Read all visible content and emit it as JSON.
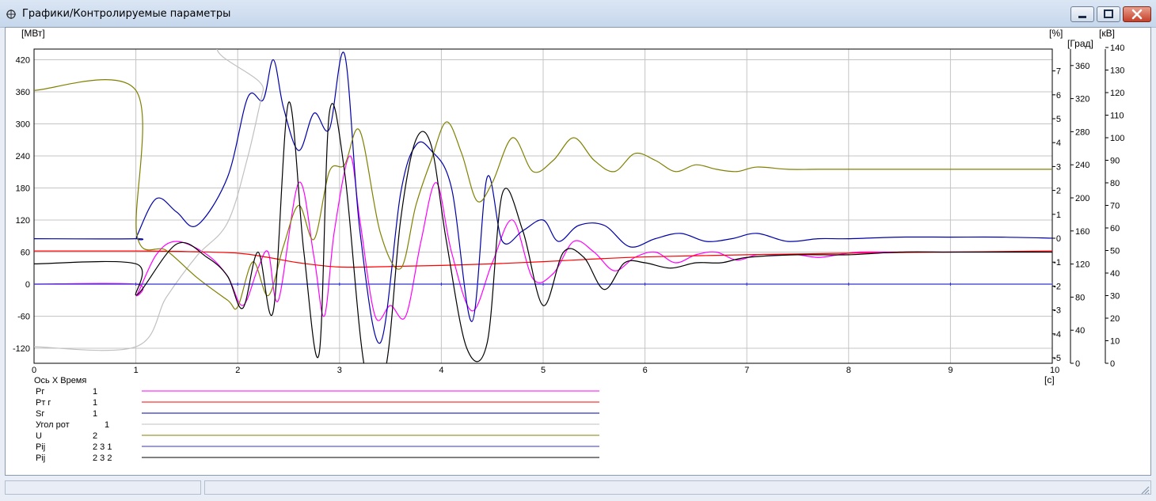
{
  "window": {
    "title": "Графики/Контролируемые параметры",
    "minimize_glyph": "—",
    "maximize_glyph": "▣",
    "close_glyph": "✕"
  },
  "axes": {
    "left_unit": "[МВт]",
    "left_ticks": [
      "420",
      "360",
      "300",
      "240",
      "180",
      "120",
      "60",
      "0",
      "-60",
      "-120"
    ],
    "pct_unit": "[%]",
    "pct_ticks": [
      "7",
      "6",
      "5",
      "4",
      "3",
      "2",
      "1",
      "0",
      "-1",
      "-2",
      "-3",
      "-4",
      "-5"
    ],
    "deg_unit": "[Град]",
    "deg_ticks": [
      "360",
      "320",
      "280",
      "240",
      "200",
      "160",
      "120",
      "80",
      "40",
      "0"
    ],
    "kv_unit": "[кВ]",
    "kv_ticks": [
      "140",
      "130",
      "120",
      "110",
      "100",
      "90",
      "80",
      "70",
      "60",
      "50",
      "40",
      "30",
      "20",
      "10",
      "0"
    ],
    "x_ticks": [
      "0",
      "1",
      "2",
      "3",
      "4",
      "5",
      "6",
      "7",
      "8",
      "9",
      "10"
    ],
    "x_unit": "[с]"
  },
  "legend": {
    "axis_label": "Ось X  Время",
    "items": [
      {
        "name": "Pг",
        "index": "1",
        "color": "#ff00ff"
      },
      {
        "name": "Pт г",
        "index": "1",
        "color": "#ff0000"
      },
      {
        "name": "Sг",
        "index": "1",
        "color": "#0000aa"
      },
      {
        "name": "Угол рот",
        "index": "1",
        "color": "#c0c0c0"
      },
      {
        "name": "U",
        "index": "2",
        "color": "#808000"
      },
      {
        "name": "Pij",
        "index": "2  3  1",
        "color": "#3333cc"
      },
      {
        "name": "Pij",
        "index": "2  3  2",
        "color": "#000000"
      }
    ]
  },
  "chart_data": {
    "type": "line",
    "xlim": [
      0,
      10
    ],
    "ylim_left": [
      -140,
      440
    ],
    "series": [
      {
        "name": "Pг",
        "axis": "МВт",
        "color": "#ff00ff",
        "x": [
          0,
          1,
          1.01,
          1.2,
          1.4,
          1.7,
          1.9,
          2.05,
          2.2,
          2.3,
          2.4,
          2.6,
          2.75,
          2.85,
          2.95,
          3.1,
          3.2,
          3.35,
          3.5,
          3.65,
          3.8,
          3.95,
          4.1,
          4.3,
          4.5,
          4.7,
          4.9,
          5.1,
          5.3,
          5.5,
          5.7,
          5.9,
          6.1,
          6.3,
          6.5,
          6.7,
          6.9,
          7.1,
          7.3,
          7.5,
          7.7,
          7.9,
          8.1,
          8.5,
          9,
          9.5,
          10
        ],
        "y": [
          0,
          0,
          -20,
          55,
          80,
          55,
          15,
          -40,
          30,
          60,
          -30,
          190,
          50,
          -60,
          100,
          240,
          120,
          -60,
          -40,
          -60,
          80,
          190,
          60,
          -50,
          40,
          120,
          10,
          20,
          80,
          60,
          25,
          50,
          60,
          40,
          55,
          60,
          45,
          55,
          55,
          55,
          50,
          55,
          60,
          60,
          60,
          60,
          60
        ]
      },
      {
        "name": "Pт г",
        "axis": "МВт",
        "color": "#ff0000",
        "x": [
          0,
          1,
          1.5,
          2,
          2.3,
          2.6,
          3,
          3.5,
          4,
          4.5,
          5,
          5.5,
          6,
          7,
          8,
          9,
          10
        ],
        "y": [
          62,
          62,
          61,
          58,
          50,
          40,
          32,
          33,
          35,
          38,
          42,
          47,
          51,
          55,
          58,
          60,
          62
        ]
      },
      {
        "name": "Sг",
        "axis": "МВт",
        "color": "#0000aa",
        "x": [
          0,
          1,
          1.01,
          1.2,
          1.4,
          1.6,
          1.9,
          2.1,
          2.25,
          2.35,
          2.45,
          2.6,
          2.75,
          2.9,
          3.05,
          3.2,
          3.4,
          3.6,
          3.75,
          3.9,
          4.1,
          4.3,
          4.45,
          4.6,
          4.8,
          5,
          5.15,
          5.35,
          5.6,
          5.85,
          6.1,
          6.35,
          6.6,
          6.85,
          7.1,
          7.4,
          7.7,
          8,
          8.5,
          9,
          9.5,
          10
        ],
        "y": [
          85,
          85,
          90,
          160,
          135,
          110,
          200,
          350,
          345,
          420,
          330,
          250,
          320,
          290,
          430,
          100,
          -110,
          170,
          260,
          250,
          180,
          -70,
          200,
          80,
          100,
          120,
          80,
          110,
          110,
          70,
          85,
          95,
          80,
          85,
          95,
          80,
          85,
          85,
          88,
          88,
          88,
          86
        ]
      },
      {
        "name": "Угол рот",
        "axis": "Град",
        "color": "#c0c0c0",
        "x": [
          0,
          1,
          1.3,
          1.6,
          1.9,
          2.1,
          2.25,
          2.4,
          10
        ],
        "y": [
          20,
          20,
          80,
          130,
          170,
          250,
          330,
          400,
          400
        ]
      },
      {
        "name": "U",
        "axis": "кВ",
        "color": "#808000",
        "x": [
          0,
          1,
          1.01,
          1.3,
          1.6,
          1.9,
          2,
          2.15,
          2.3,
          2.45,
          2.6,
          2.75,
          2.9,
          3.05,
          3.2,
          3.4,
          3.6,
          3.75,
          3.9,
          4.05,
          4.2,
          4.35,
          4.5,
          4.7,
          4.9,
          5.1,
          5.3,
          5.5,
          5.7,
          5.9,
          6.1,
          6.3,
          6.5,
          6.7,
          6.9,
          7.1,
          7.4,
          7.7,
          8,
          8.5,
          9,
          9.5,
          10
        ],
        "y": [
          121,
          121,
          57,
          50,
          38,
          28,
          25,
          45,
          30,
          52,
          70,
          55,
          85,
          88,
          103,
          58,
          42,
          70,
          90,
          107,
          93,
          72,
          80,
          100,
          85,
          90,
          100,
          90,
          85,
          93,
          90,
          85,
          88,
          86,
          85,
          87,
          86,
          86,
          86,
          86,
          86,
          86,
          86
        ]
      },
      {
        "name": "Pij 2 3 1",
        "axis": "МВт",
        "color": "#3333cc",
        "x": [
          0,
          10
        ],
        "y": [
          0,
          0
        ]
      },
      {
        "name": "Pij 2 3 2",
        "axis": "МВт",
        "color": "#000000",
        "x": [
          0,
          1,
          1.01,
          1.4,
          1.7,
          1.9,
          2.05,
          2.2,
          2.35,
          2.5,
          2.65,
          2.8,
          2.9,
          3.05,
          3.25,
          3.45,
          3.6,
          3.75,
          3.9,
          4.05,
          4.25,
          4.45,
          4.6,
          4.8,
          5,
          5.2,
          5.4,
          5.6,
          5.8,
          6,
          6.25,
          6.5,
          6.75,
          7,
          7.5,
          8,
          8.5,
          9,
          9.5,
          10
        ],
        "y": [
          38,
          38,
          -20,
          75,
          50,
          15,
          -45,
          60,
          -50,
          340,
          60,
          -130,
          320,
          210,
          -160,
          -160,
          120,
          270,
          260,
          80,
          -120,
          -110,
          170,
          100,
          -40,
          60,
          50,
          -10,
          40,
          40,
          30,
          40,
          40,
          50,
          55,
          55,
          60,
          60,
          60,
          60
        ]
      }
    ]
  }
}
